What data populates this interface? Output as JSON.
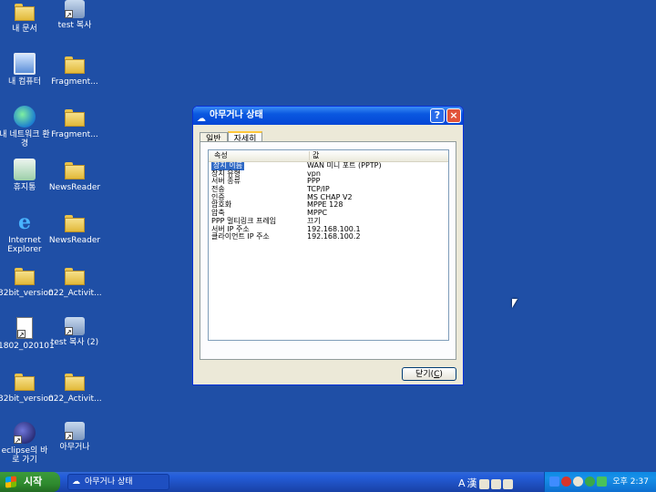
{
  "desktop": {
    "icons": [
      {
        "label": "내 문서",
        "kind": "folder"
      },
      {
        "label": "test 복사",
        "kind": "netdrive"
      },
      {
        "label": "내 컴퓨터",
        "kind": "computer"
      },
      {
        "label": "Fragment...",
        "kind": "folder"
      },
      {
        "label": "내 네트워크 환경",
        "kind": "network"
      },
      {
        "label": "Fragment...",
        "kind": "folder"
      },
      {
        "label": "휴지통",
        "kind": "recycle"
      },
      {
        "label": "NewsReader",
        "kind": "folder"
      },
      {
        "label": "Internet Explorer",
        "kind": "ie"
      },
      {
        "label": "NewsReader",
        "kind": "folder"
      },
      {
        "label": "32bit_version",
        "kind": "folder"
      },
      {
        "label": "022_Activit...",
        "kind": "folder"
      },
      {
        "label": "1802_020101",
        "kind": "docfile"
      },
      {
        "label": "test 복사 (2)",
        "kind": "netdrive"
      },
      {
        "label": "32bit_version",
        "kind": "folder"
      },
      {
        "label": "022_Activit...",
        "kind": "folder"
      },
      {
        "label": "eclipse의 바로 가기",
        "kind": "eclipse"
      },
      {
        "label": "아무거나",
        "kind": "netdrive"
      }
    ]
  },
  "dialog": {
    "title": "아무거나 상태",
    "help_label": "?",
    "close_x_label": "×",
    "tabs": [
      {
        "label": "일반",
        "active": false
      },
      {
        "label": "자세히",
        "active": true
      }
    ],
    "columns": {
      "property": "속성",
      "value": "값"
    },
    "rows": [
      {
        "k": "장치 이름",
        "v": "WAN 미니 포트 (PPTP)",
        "selected": true
      },
      {
        "k": "장치 유형",
        "v": "vpn"
      },
      {
        "k": "서버 종류",
        "v": "PPP"
      },
      {
        "k": "전송",
        "v": "TCP/IP"
      },
      {
        "k": "인증",
        "v": "MS CHAP V2"
      },
      {
        "k": "암호화",
        "v": "MPPE 128"
      },
      {
        "k": "압축",
        "v": "MPPC"
      },
      {
        "k": "PPP 멀티링크 프레임",
        "v": "끄기"
      },
      {
        "k": "서버 IP 주소",
        "v": "192.168.100.1"
      },
      {
        "k": "클라이언트 IP 주소",
        "v": "192.168.100.2"
      }
    ],
    "close_button": {
      "label": "닫기(",
      "mnemonic": "C",
      "suffix": ")"
    }
  },
  "taskbar": {
    "start_label": "시작",
    "task_label": "아무거나 상태",
    "lang_a": "A",
    "lang_han": "漢",
    "clock": "오후 2:37"
  }
}
